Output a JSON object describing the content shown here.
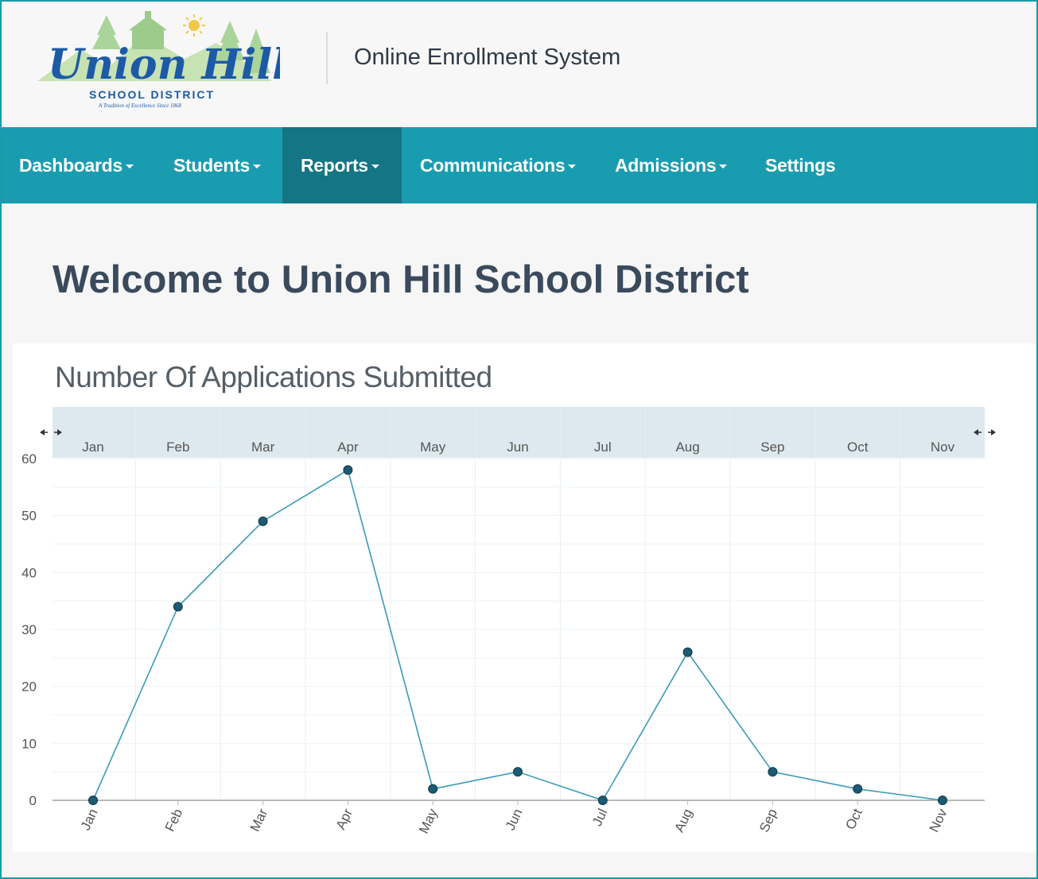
{
  "header": {
    "logo": {
      "name_line": "Union Hill",
      "district_line": "SCHOOL DISTRICT",
      "tagline": "A Tradition of Excellence Since 1868"
    },
    "app_title": "Online Enrollment System"
  },
  "nav": {
    "items": [
      {
        "label": "Dashboards",
        "has_dropdown": true
      },
      {
        "label": "Students",
        "has_dropdown": true
      },
      {
        "label": "Reports",
        "has_dropdown": true,
        "active": true
      },
      {
        "label": "Communications",
        "has_dropdown": true
      },
      {
        "label": "Admissions",
        "has_dropdown": true
      },
      {
        "label": "Settings",
        "has_dropdown": false
      }
    ]
  },
  "main": {
    "welcome_title": "Welcome to Union Hill School District"
  },
  "colors": {
    "brand_teal": "#1a9cb0",
    "active_nav": "#147584",
    "line_color": "#3a9bb5",
    "marker_color": "#1d5a73"
  },
  "chart_data": {
    "type": "line",
    "title": "Number Of Applications Submitted",
    "categories": [
      "Jan",
      "Feb",
      "Mar",
      "Apr",
      "May",
      "Jun",
      "Jul",
      "Aug",
      "Sep",
      "Oct",
      "Nov"
    ],
    "values": [
      0,
      34,
      49,
      58,
      2,
      5,
      0,
      26,
      5,
      2,
      0
    ],
    "ylim": [
      0,
      60
    ],
    "yticks": [
      0,
      10,
      20,
      30,
      40,
      50,
      60
    ],
    "grid": true,
    "top_axis": true
  }
}
